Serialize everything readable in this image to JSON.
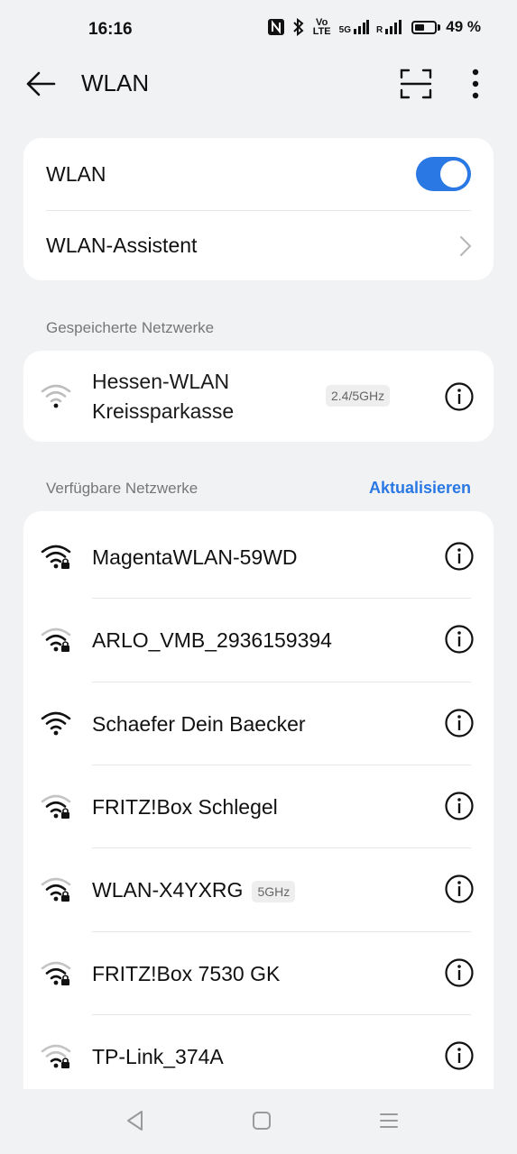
{
  "status_bar": {
    "time": "16:16",
    "volte_label": "Vo LTE",
    "signal1_label": "5G",
    "signal2_label": "R",
    "battery_percent": "49 %",
    "battery_level": 0.49
  },
  "app_bar": {
    "title": "WLAN",
    "back_icon": "arrow-left-icon",
    "scan_icon": "qr-scan-icon",
    "more_icon": "more-vertical-icon"
  },
  "main_card": {
    "wlan_label": "WLAN",
    "wlan_enabled": true,
    "assistant_label": "WLAN-Assistent"
  },
  "saved": {
    "header": "Gespeicherte Netzwerke",
    "networks": [
      {
        "name_line1": "Hessen-WLAN",
        "name_line2": "Kreissparkasse",
        "band": "2.4/5GHz",
        "secured": false
      }
    ]
  },
  "available": {
    "header": "Verfügbare Netzwerke",
    "refresh_label": "Aktualisieren",
    "networks": [
      {
        "name": "MagentaWLAN-59WD",
        "band": "",
        "secured": true,
        "strength": 3
      },
      {
        "name": "ARLO_VMB_2936159394",
        "band": "",
        "secured": true,
        "strength": 2
      },
      {
        "name": "Schaefer Dein Baecker",
        "band": "",
        "secured": false,
        "strength": 3
      },
      {
        "name": "FRITZ!Box Schlegel",
        "band": "",
        "secured": true,
        "strength": 2
      },
      {
        "name": "WLAN-X4YXRG",
        "band": "5GHz",
        "secured": true,
        "strength": 2
      },
      {
        "name": "FRITZ!Box 7530 GK",
        "band": "",
        "secured": true,
        "strength": 2
      },
      {
        "name": "TP-Link_374A",
        "band": "",
        "secured": true,
        "strength": 1
      }
    ]
  },
  "colors": {
    "accent": "#2a78e4",
    "background": "#f1f2f4",
    "card": "#ffffff"
  }
}
